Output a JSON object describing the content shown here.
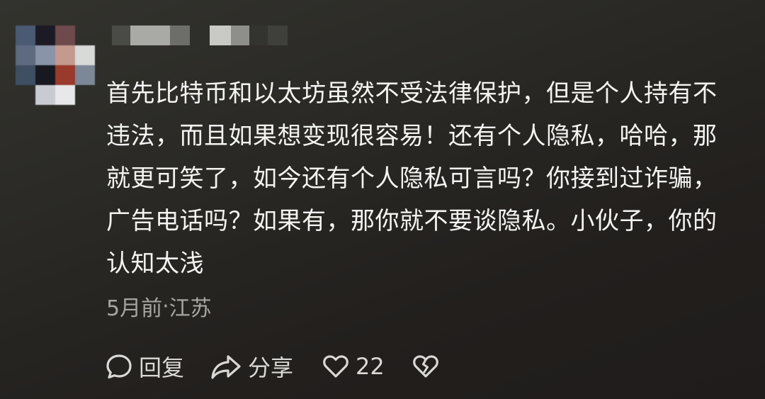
{
  "comment": {
    "lines": [
      "首先比特币和以太坊虽然不受法律保护，但是个人持有不",
      "违法，而且如果想变现很容易！还有个人隐私，哈哈，那",
      "就更可笑了，如今还有个人隐私可言吗？你接到过诈骗，",
      "广告电话吗？如果有，那你就不要谈隐私。小伙子，你的",
      "认知太浅"
    ],
    "time": "5月前",
    "separator": "·",
    "location": "江苏"
  },
  "actions": {
    "reply_label": "回复",
    "share_label": "分享",
    "like_count": "22"
  },
  "icons": {
    "reply": "speech-bubble-icon",
    "share": "share-arrow-icon",
    "like": "heart-icon",
    "dislike": "broken-heart-icon"
  },
  "colors": {
    "background": "#2a2925",
    "text": "#f4f4f2",
    "meta_text": "#a8a6a2",
    "action_text": "#d9d8d5"
  }
}
